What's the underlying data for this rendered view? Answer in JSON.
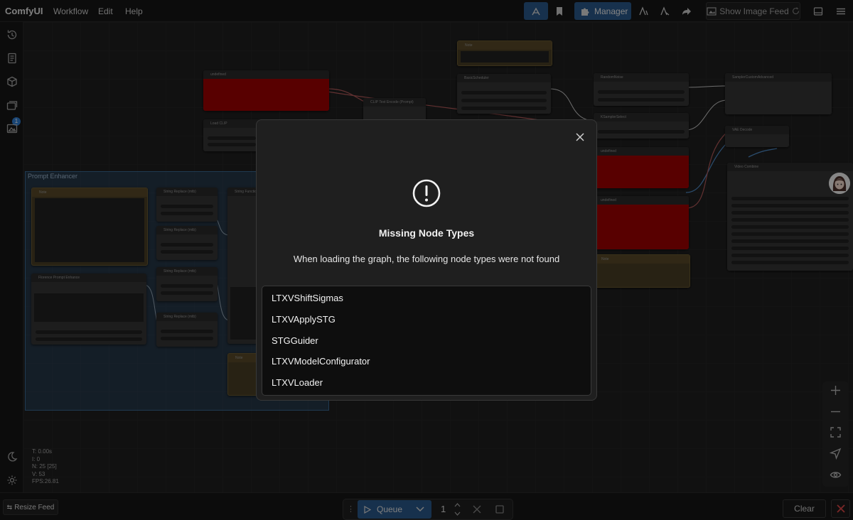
{
  "app": {
    "brand": "ComfyUI"
  },
  "menu": {
    "items": [
      "Workflow",
      "Edit",
      "Help"
    ]
  },
  "toolbar": {
    "manager_label": "Manager",
    "show_image_feed_label": "Show Image Feed"
  },
  "sidebar": {
    "queue_badge": "1"
  },
  "canvas": {
    "group_title": "Prompt Enhancer",
    "nodes": {
      "undefined_title": "undefined",
      "load_clip_title": "Load CLIP",
      "clip_text_encode_title": "CLIP Text Encode (Prompt)",
      "note_title": "Note",
      "basic_scheduler_title": "BasicScheduler",
      "random_noise_title": "RandomNoise",
      "ksampler_select_title": "KSamplerSelect",
      "sampler_custom_advanced_title": "SamplerCustomAdvanced",
      "vae_decode_title": "VAE Decode",
      "video_combine_title": "Video Combine",
      "string_replace_title": "String Replace (mtb)",
      "string_function_title": "String Function",
      "florence_title": "Florence Prompt Enhance"
    }
  },
  "stats": {
    "t": "T: 0.00s",
    "i": "I: 0",
    "n": "N: 25 [25]",
    "v": "V: 53",
    "fps": "FPS:26.81"
  },
  "bottom": {
    "resize_feed_label": "Resize Feed",
    "queue_label": "Queue",
    "queue_count": "1",
    "clear_label": "Clear"
  },
  "dialog": {
    "title": "Missing Node Types",
    "message": "When loading the graph, the following node types were not found",
    "missing_nodes": [
      "LTXVShiftSigmas",
      "LTXVApplySTG",
      "STGGuider",
      "LTXVModelConfigurator",
      "LTXVLoader"
    ]
  },
  "colors": {
    "accent": "#2b5a8c",
    "danger": "#e04848",
    "node_error": "#a00000"
  }
}
